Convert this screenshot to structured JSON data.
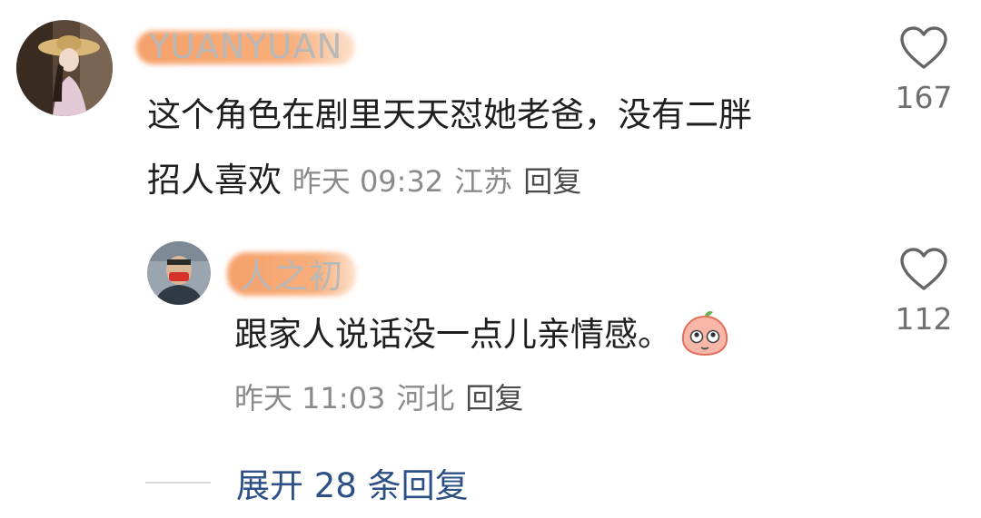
{
  "comments": [
    {
      "username": "YUANYUAN",
      "text_line1": "这个角色在剧里天天怼她老爸，没有二胖",
      "text_line2": "招人喜欢",
      "time": "昨天 09:32",
      "location": "江苏",
      "reply_label": "回复",
      "likes": "167"
    },
    {
      "username": "人之初",
      "text": "跟家人说话没一点儿亲情感。",
      "time": "昨天 11:03",
      "location": "河北",
      "reply_label": "回复",
      "likes": "112"
    }
  ],
  "expand_label": "展开 28 条回复",
  "colors": {
    "link": "#2c4f86",
    "meta": "#8a8a8a",
    "redact": "#f4965a"
  }
}
